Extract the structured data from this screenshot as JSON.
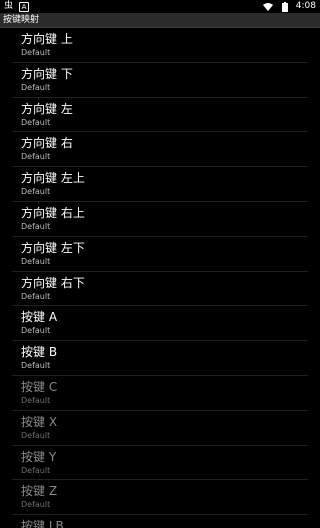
{
  "status_bar": {
    "left_icons": [
      "bug-icon",
      "a-icon"
    ],
    "time": "4:08",
    "right_icons": [
      "wifi-icon",
      "battery-icon"
    ]
  },
  "title_bar": {
    "title": "按键映射"
  },
  "items": [
    {
      "label": "方向键 上",
      "value": "Default",
      "enabled": true
    },
    {
      "label": "方向键 下",
      "value": "Default",
      "enabled": true
    },
    {
      "label": "方向键 左",
      "value": "Default",
      "enabled": true
    },
    {
      "label": "方向键 右",
      "value": "Default",
      "enabled": true
    },
    {
      "label": "方向键 左上",
      "value": "Default",
      "enabled": true
    },
    {
      "label": "方向键 右上",
      "value": "Default",
      "enabled": true
    },
    {
      "label": "方向键 左下",
      "value": "Default",
      "enabled": true
    },
    {
      "label": "方向键 右下",
      "value": "Default",
      "enabled": true
    },
    {
      "label": "按键 A",
      "value": "Default",
      "enabled": true
    },
    {
      "label": "按键 B",
      "value": "Default",
      "enabled": true
    },
    {
      "label": "按键 C",
      "value": "Default",
      "enabled": false
    },
    {
      "label": "按键 X",
      "value": "Default",
      "enabled": false
    },
    {
      "label": "按键 Y",
      "value": "Default",
      "enabled": false
    },
    {
      "label": "按键 Z",
      "value": "Default",
      "enabled": false
    },
    {
      "label": "按键 LB",
      "value": "",
      "enabled": false
    }
  ],
  "colors": {
    "background": "#000000",
    "title_bar": "#2b2b2b",
    "enabled_text": "#ffffff",
    "disabled_text": "#8a8a8a",
    "subtitle": "#bdbdbd",
    "divider": "#202020"
  }
}
